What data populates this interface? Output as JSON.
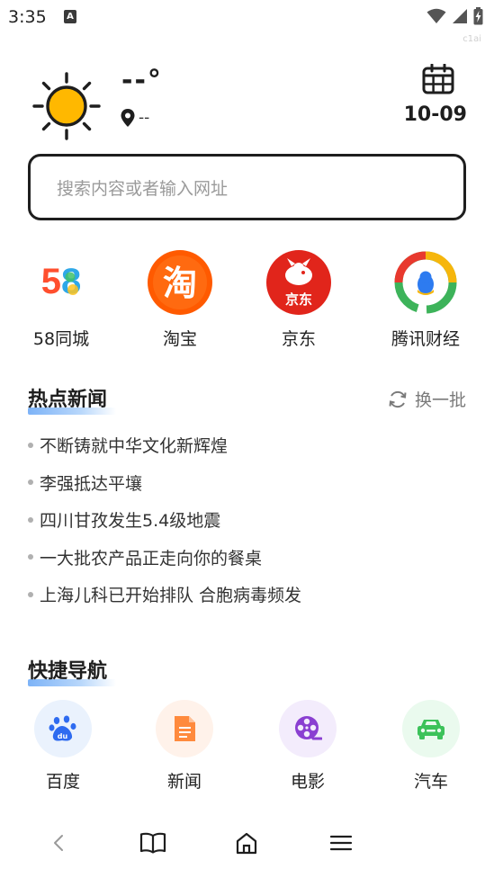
{
  "status_bar": {
    "time": "3:35",
    "notification_glyph": "A",
    "icons": [
      "wifi-icon",
      "cell-signal-icon",
      "battery-charging-icon"
    ],
    "watermark": "c1ai"
  },
  "weather": {
    "temperature": "--°",
    "location": "--",
    "date": "10-09",
    "icons": [
      "sun-icon",
      "location-pin-icon",
      "calendar-icon"
    ]
  },
  "search": {
    "placeholder": "搜索内容或者输入网址"
  },
  "top_sites": [
    {
      "label": "58同城",
      "logo_text": "58",
      "icon": "58-logo-icon"
    },
    {
      "label": "淘宝",
      "logo_text": "淘",
      "icon": "taobao-logo-icon",
      "color": "#ff5a00"
    },
    {
      "label": "京东",
      "logo_text": "京东",
      "icon": "jd-logo-icon",
      "color": "#e1251b"
    },
    {
      "label": "腾讯财经",
      "icon": "tencent-finance-logo-icon"
    }
  ],
  "hot_news": {
    "title": "热点新闻",
    "refresh_label": "换一批",
    "items": [
      "不断铸就中华文化新辉煌",
      "李强抵达平壤",
      "四川甘孜发生5.4级地震",
      "一大批农产品正走向你的餐桌",
      "上海儿科已开始排队 合胞病毒频发"
    ]
  },
  "quick_nav": {
    "title": "快捷导航",
    "items": [
      {
        "label": "百度",
        "icon": "baidu-paw-icon",
        "color": "#2e6bf0",
        "bg": "#eaf2fd"
      },
      {
        "label": "新闻",
        "icon": "news-document-icon",
        "color": "#ff8a3d",
        "bg": "#fff2ea"
      },
      {
        "label": "电影",
        "icon": "film-reel-icon",
        "color": "#8a3fd1",
        "bg": "#f3ecfc"
      },
      {
        "label": "汽车",
        "icon": "car-icon",
        "color": "#3cc25a",
        "bg": "#eafaee"
      }
    ]
  },
  "bottom_nav": {
    "icons": [
      "back-icon",
      "bookmarks-icon",
      "home-icon",
      "menu-icon"
    ]
  }
}
